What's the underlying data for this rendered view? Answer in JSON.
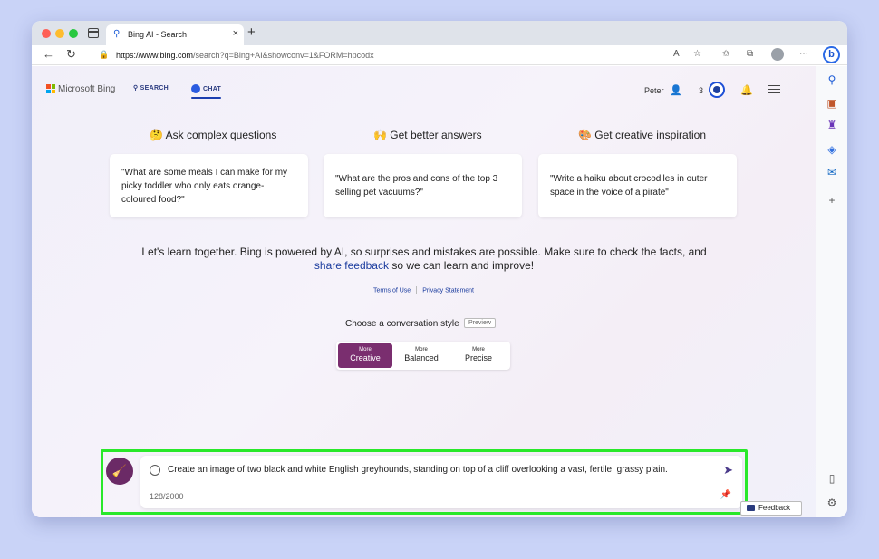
{
  "browser": {
    "tab_title": "Bing AI - Search",
    "url_host": "https://www.bing.com",
    "url_path": "/search?q=Bing+AI&showconv=1&FORM=hpcodx"
  },
  "header": {
    "logo_text": "Microsoft Bing",
    "nav_search": "SEARCH",
    "nav_chat": "CHAT",
    "user_name": "Peter",
    "points": "3"
  },
  "columns": [
    {
      "heading": "🤔 Ask complex questions",
      "example": "\"What are some meals I can make for my picky toddler who only eats orange-coloured food?\""
    },
    {
      "heading": "🙌 Get better answers",
      "example": "\"What are the pros and cons of the top 3 selling pet vacuums?\""
    },
    {
      "heading": "🎨 Get creative inspiration",
      "example": "\"Write a haiku about crocodiles in outer space in the voice of a pirate\""
    }
  ],
  "disclaimer": {
    "text_before": "Let's learn together. Bing is powered by AI, so surprises and mistakes are possible. Make sure to check the facts, and",
    "link": "share feedback",
    "text_after": "so we can learn and improve!"
  },
  "legal": {
    "terms": "Terms of Use",
    "privacy": "Privacy Statement"
  },
  "conversation_style": {
    "label": "Choose a conversation style",
    "badge": "Preview",
    "options": [
      {
        "small": "More",
        "large": "Creative",
        "selected": true
      },
      {
        "small": "More",
        "large": "Balanced",
        "selected": false
      },
      {
        "small": "More",
        "large": "Precise",
        "selected": false
      }
    ]
  },
  "input": {
    "prompt": "Create an image of two black and white English greyhounds, standing on top of a cliff overlooking a vast, fertile, grassy plain.",
    "counter": "128/2000"
  },
  "feedback_label": "Feedback",
  "colors": {
    "accent_purple": "#7a2e6f",
    "highlight_green": "#29e82a",
    "link_blue": "#1a3b9e"
  }
}
